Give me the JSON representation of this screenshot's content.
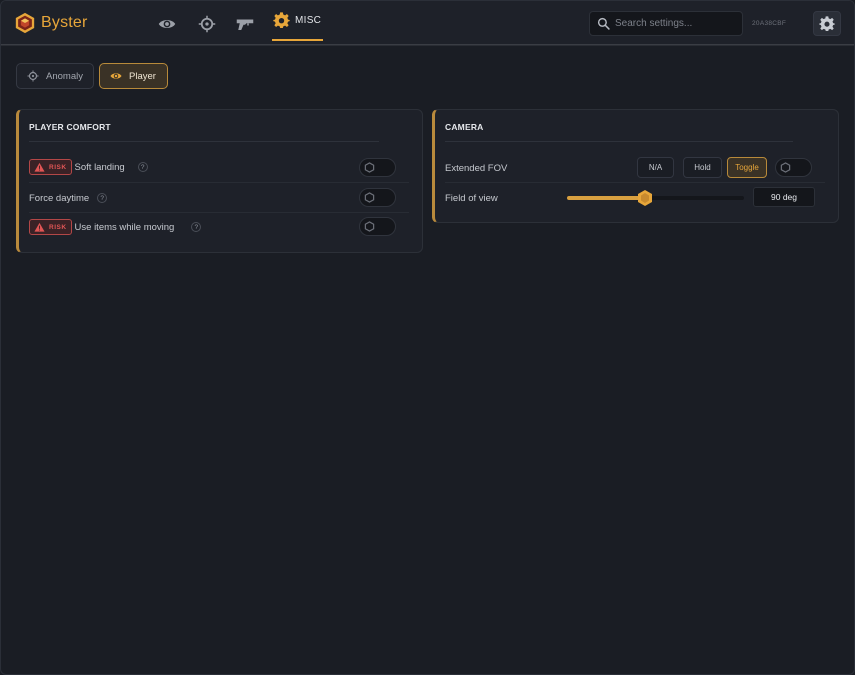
{
  "app": {
    "name": "Byster",
    "hwid": "20A38CBF",
    "accent": "#e7a63a"
  },
  "nav": {
    "tabs": [
      {
        "id": "visuals",
        "icon": "eye-icon"
      },
      {
        "id": "aim",
        "icon": "crosshair-icon"
      },
      {
        "id": "weapons",
        "icon": "gun-icon"
      },
      {
        "id": "misc",
        "icon": "gear-icon",
        "label": "MISC",
        "active": true
      }
    ]
  },
  "search": {
    "placeholder": "Search settings..."
  },
  "subtabs": [
    {
      "label": "Anomaly",
      "icon": "crosshair-icon",
      "active": false
    },
    {
      "label": "Player",
      "icon": "eye-icon",
      "active": true
    }
  ],
  "panels": {
    "player_comfort": {
      "title": "PLAYER COMFORT",
      "rows": [
        {
          "label": "Soft landing",
          "risk": true,
          "risk_label": "RISK",
          "help": "?",
          "enabled": false
        },
        {
          "label": "Force daytime",
          "risk": false,
          "help": "?",
          "enabled": false
        },
        {
          "label": "Use items while moving",
          "risk": true,
          "risk_label": "RISK",
          "help": "?",
          "enabled": false
        }
      ]
    },
    "camera": {
      "title": "CAMERA",
      "extended_fov": {
        "label": "Extended FOV",
        "modes": [
          "N/A",
          "Hold",
          "Toggle"
        ],
        "selected_mode": "Toggle",
        "enabled": false
      },
      "field_of_view": {
        "label": "Field of view",
        "value_text": "90 deg",
        "fill_fraction": 0.44
      }
    }
  }
}
